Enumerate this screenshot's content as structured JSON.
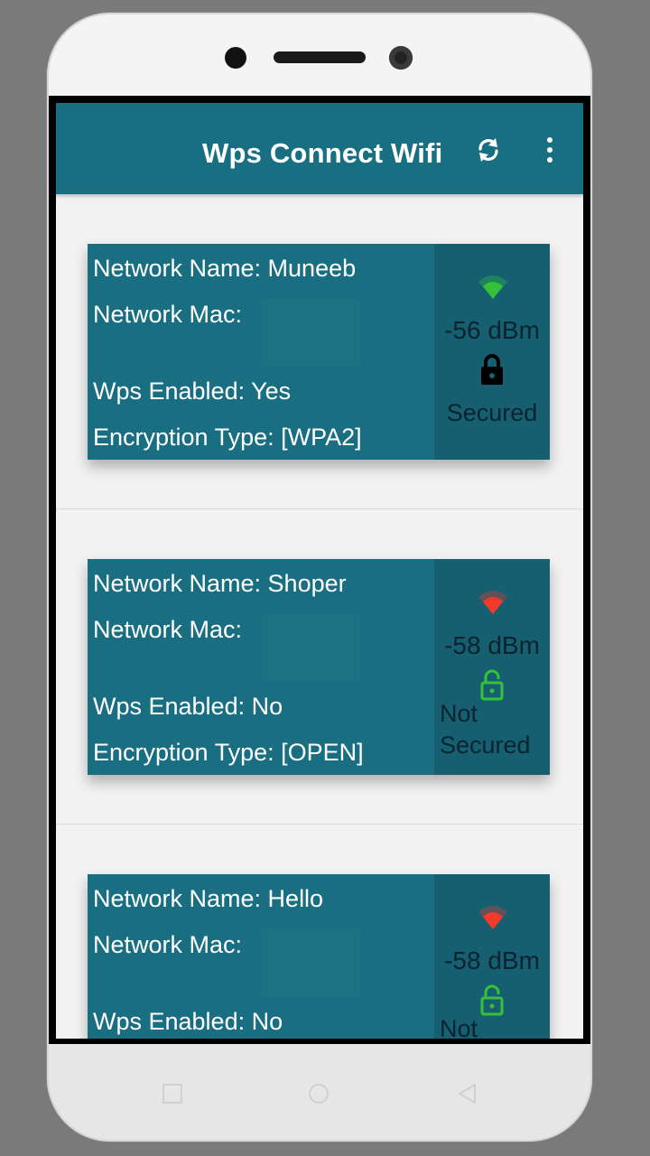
{
  "appbar": {
    "title": "Wps Connect Wifi",
    "refresh_icon": "refresh-icon",
    "menu_icon": "more-vert-icon"
  },
  "colors": {
    "primary": "#186f81",
    "status_panel": "#165f70",
    "signal_good": "#35c23a",
    "signal_weak": "#f23a2a",
    "lock_open": "#35c23a",
    "lock_closed": "#000000"
  },
  "networks": [
    {
      "name_line": "Network Name: Muneeb",
      "mac_line": "Network Mac:",
      "wps_line": "Wps Enabled: Yes",
      "enc_line": "Encryption Type: [WPA2]",
      "signal": "-56 dBm",
      "security": "Secured",
      "signal_color": "#35c23a",
      "lock": "lock-closed-icon"
    },
    {
      "name_line": "Network Name: Shoper",
      "mac_line": "Network Mac:",
      "wps_line": "Wps Enabled: No",
      "enc_line": "Encryption Type: [OPEN]",
      "signal": "-58 dBm",
      "security_l1": "Not",
      "security_l2": "Secured",
      "signal_color": "#f23a2a",
      "lock": "lock-open-icon"
    },
    {
      "name_line": "Network Name: Hello",
      "mac_line": "Network Mac:",
      "wps_line": "Wps Enabled: No",
      "signal": "-58 dBm",
      "security_l1": "Not",
      "signal_color": "#f23a2a",
      "lock": "lock-open-icon"
    }
  ],
  "navigation": {
    "recents_icon": "square-recents-icon",
    "home_icon": "circle-home-icon",
    "back_icon": "triangle-back-icon"
  }
}
